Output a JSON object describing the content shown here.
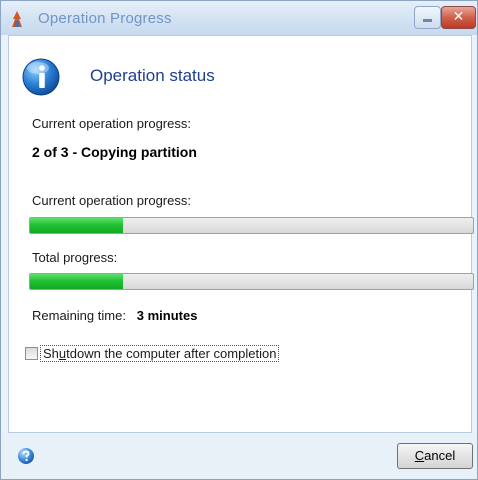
{
  "window": {
    "title": "Operation Progress",
    "minimize_glyph": "",
    "close_glyph": "✕"
  },
  "main": {
    "heading": "Operation status",
    "current_label": "Current operation progress:",
    "current_step": "2 of 3 - Copying partition",
    "current_progress_label": "Current operation progress:",
    "current_progress": 0.21,
    "total_label": "Total progress:",
    "total_progress": 0.21,
    "remaining_label": "Remaining time:",
    "remaining_value": "3 minutes",
    "shutdown": {
      "label_prefix": "Sh",
      "label_mnemonic": "u",
      "label_suffix": "tdown the computer after completion",
      "checked": false
    }
  },
  "footer": {
    "cancel_mnemonic": "C",
    "cancel_rest": "ancel"
  },
  "icons": {
    "app": "app-icon",
    "info": "info-icon",
    "help": "help-icon"
  },
  "colors": {
    "progress_fill": "#22c236",
    "heading": "#1e3f8f",
    "close": "#c8432d"
  }
}
